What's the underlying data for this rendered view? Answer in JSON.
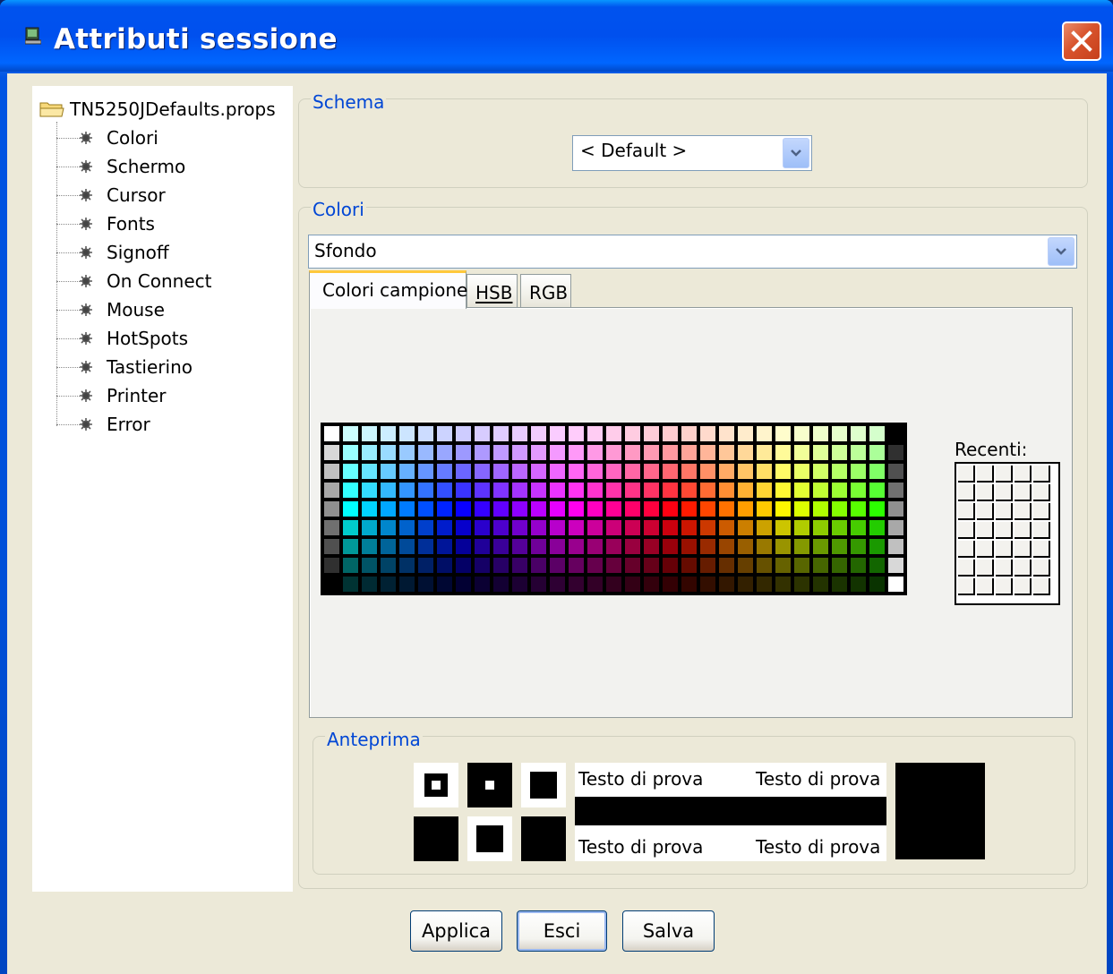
{
  "window": {
    "title": "Attributi sessione",
    "icon": "terminal-icon"
  },
  "tree": {
    "root": "TN5250JDefaults.props",
    "items": [
      "Colori",
      "Schermo",
      "Cursor",
      "Fonts",
      "Signoff",
      "On Connect",
      "Mouse",
      "HotSpots",
      "Tastierino",
      "Printer",
      "Error"
    ]
  },
  "schema": {
    "label": "Schema",
    "selected": "< Default >"
  },
  "colori": {
    "label": "Colori",
    "selected": "Sfondo",
    "tabs": [
      {
        "label": "Colori campione",
        "active": true
      },
      {
        "label": "HSB",
        "active": false
      },
      {
        "label": "RGB",
        "active": false
      }
    ],
    "recent_label": "Recenti:"
  },
  "preview": {
    "label": "Anteprima",
    "sample_text": [
      "Testo di prova",
      "Testo di prova",
      "Testo di prova",
      "Testo di prova"
    ],
    "color": "#000000"
  },
  "buttons": {
    "apply": "Applica",
    "exit": "Esci",
    "save": "Salva"
  },
  "colors": {
    "accent": "#0046d5",
    "title_bar": "#0054e3",
    "face": "#ece9d8",
    "close": "#d8532c"
  }
}
